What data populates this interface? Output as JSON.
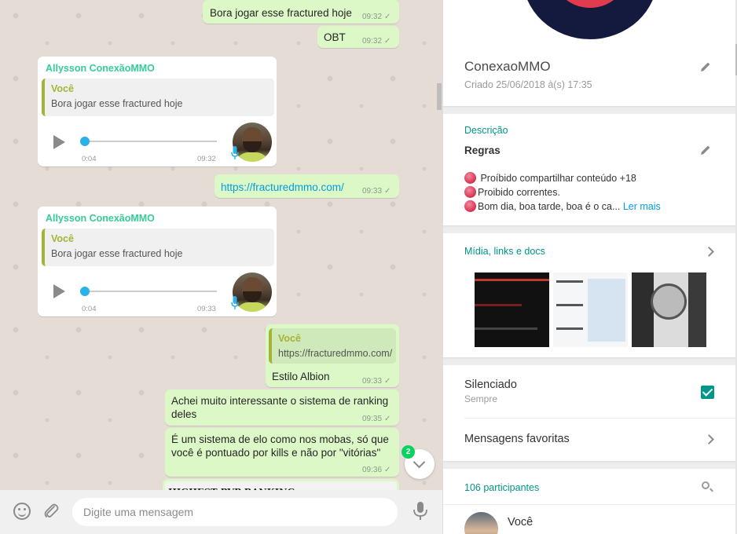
{
  "chat": {
    "messages": {
      "m1": {
        "text": "Bora jogar esse fractured hoje",
        "time": "09:32"
      },
      "m2": {
        "text": "OBT",
        "time": "09:32"
      },
      "m3": {
        "sender": "Allysson ConexãoMMO",
        "quote_name": "Você",
        "quote_text": "Bora jogar esse fractured hoje",
        "audio_duration": "0:04",
        "time": "09:32"
      },
      "m4": {
        "text": "https://fracturedmmo.com/",
        "time": "09:33"
      },
      "m5": {
        "sender": "Allysson ConexãoMMO",
        "quote_name": "Você",
        "quote_text": "Bora jogar esse fractured hoje",
        "audio_duration": "0:04",
        "time": "09:33"
      },
      "m6": {
        "quote_name": "Você",
        "quote_text": "https://fracturedmmo.com/",
        "text": "Estilo Albion",
        "time": "09:33"
      },
      "m7": {
        "line1": "Achei muito interessante o sistema de ranking",
        "line2": "deles",
        "time": "09:35"
      },
      "m8": {
        "line1": "É um sistema de elo como nos mobas, só que",
        "line2": "você é pontuado por kills e não por \"vitórias\"",
        "time": "09:36"
      },
      "m9": {
        "text": "HIGHEST PVP RANKING"
      }
    },
    "unread_badge": "2",
    "tick": "✓"
  },
  "composer": {
    "placeholder": "Digite uma mensagem"
  },
  "group_info": {
    "name": "ConexaoMMO",
    "created": "Criado 25/06/2018 à(s) 17:35",
    "description_label": "Descrição",
    "description_title": "Regras",
    "description_lines": [
      " Proíbido compartilhar conteúdo +18",
      "Proibido correntes.",
      "Bom dia, boa tarde, boa é o ca..."
    ],
    "read_more": "Ler mais",
    "media_label": "Mídia, links e docs",
    "muted_label": "Silenciado",
    "muted_sub": "Sempre",
    "muted": true,
    "starred_label": "Mensagens favoritas",
    "participants_label": "106 participantes",
    "participant_first": "Você"
  },
  "colors": {
    "accent": "#009688",
    "sender": "#35cd96",
    "quote_bar": "#a5b337",
    "link": "#039be5",
    "outgoing_bubble": "#dcf8c6"
  }
}
